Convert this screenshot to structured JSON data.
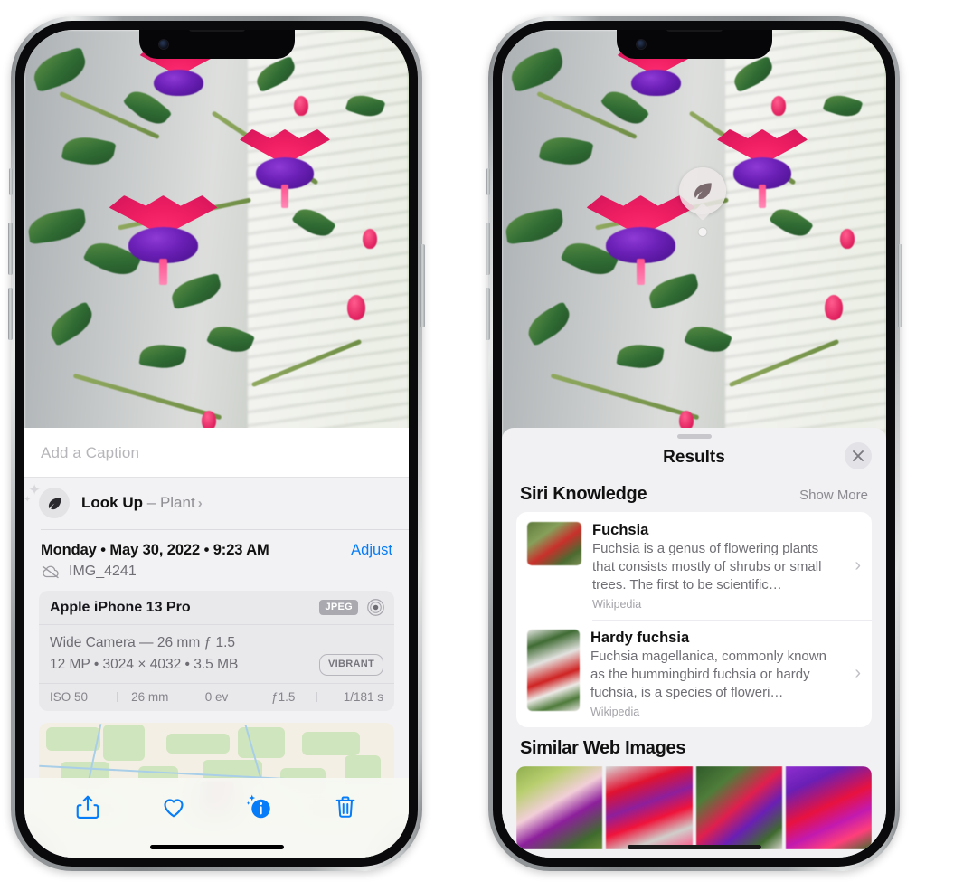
{
  "app": "Photos",
  "left_phone": {
    "photo": {
      "subject": "fuchsia-flowers-hanging-basket"
    },
    "caption_field": {
      "placeholder": "Add a Caption",
      "value": ""
    },
    "lookup": {
      "icon": "leaf-icon",
      "label": "Look Up",
      "dash": "–",
      "subject": "Plant",
      "chevron": "›"
    },
    "meta": {
      "date": "Monday • May 30, 2022 • 9:23 AM",
      "adjust_label": "Adjust",
      "cloud_icon": "cloud-slash-icon",
      "filename": "IMG_4241"
    },
    "exif": {
      "device": "Apple iPhone 13 Pro",
      "format_badge": "JPEG",
      "aperture_icon": "aperture-icon",
      "lens_line": "Wide Camera — 26 mm ƒ 1.5",
      "size_line": "12 MP • 3024 × 4032 • 3.5 MB",
      "style_badge": "VIBRANT",
      "stats": [
        "ISO 50",
        "26 mm",
        "0 ev",
        "ƒ1.5",
        "1/181 s"
      ]
    },
    "map": {
      "pin": "photo-thumbnail-pin"
    },
    "toolbar": [
      {
        "name": "share-icon",
        "label": "Share"
      },
      {
        "name": "heart-icon",
        "label": "Favorite"
      },
      {
        "name": "info-sparkle-icon",
        "label": "Info"
      },
      {
        "name": "trash-icon",
        "label": "Delete"
      }
    ]
  },
  "right_phone": {
    "photo_badge": {
      "icon": "leaf-icon",
      "label": "Visual Look Up plant badge"
    },
    "sheet": {
      "grabber": "sheet-grabber",
      "title": "Results",
      "close_icon": "close-icon"
    },
    "siri_knowledge": {
      "title": "Siri Knowledge",
      "show_more": "Show More",
      "items": [
        {
          "name": "Fuchsia",
          "description": "Fuchsia is a genus of flowering plants that consists mostly of shrubs or small trees. The first to be scientific…",
          "source": "Wikipedia",
          "chevron": "›"
        },
        {
          "name": "Hardy fuchsia",
          "description": "Fuchsia magellanica, commonly known as the hummingbird fuchsia or hardy fuchsia, is a species of floweri…",
          "source": "Wikipedia",
          "chevron": "›"
        }
      ]
    },
    "similar_web_images": {
      "title": "Similar Web Images",
      "thumbnails": [
        "fuchsia-web-image-1",
        "fuchsia-web-image-2",
        "fuchsia-web-image-3",
        "fuchsia-web-image-4"
      ]
    }
  },
  "colors": {
    "accent_blue": "#067cf8",
    "sheet_bg": "#f1f1f4",
    "card_white": "#ffffff",
    "secondary_text": "#8a8a90"
  }
}
